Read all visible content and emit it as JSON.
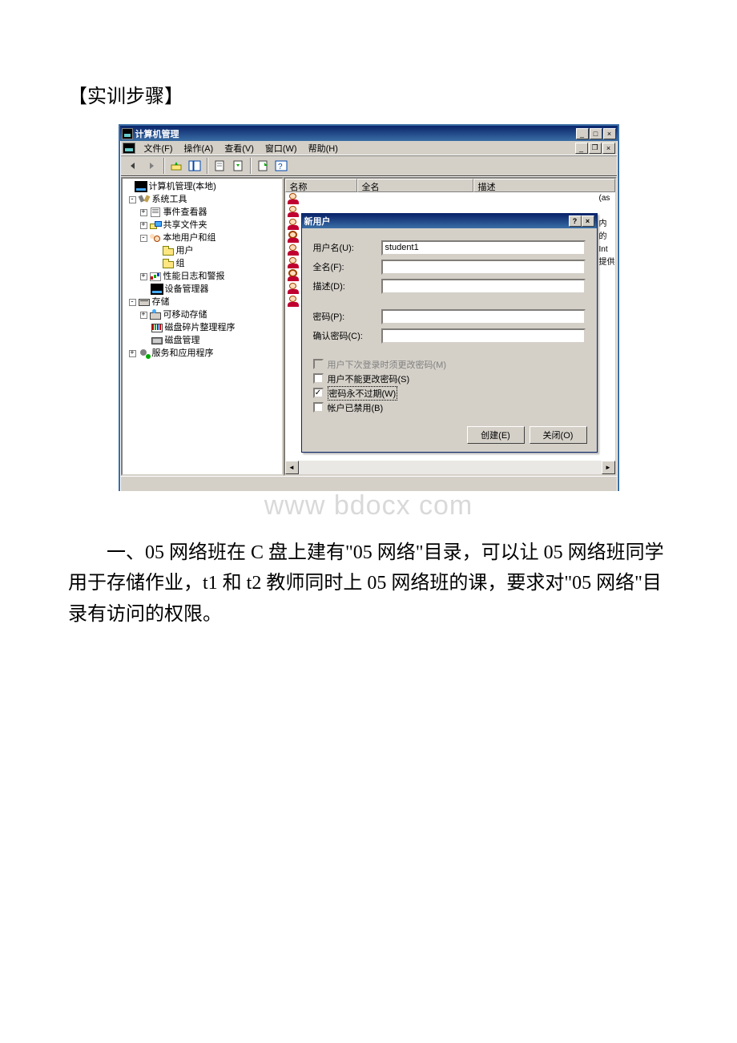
{
  "page": {
    "heading": "【实训步骤】",
    "body": "一、05 网络班在 C 盘上建有\"05 网络\"目录，可以让 05 网络班同学用于存储作业，t1 和 t2 教师同时上 05 网络班的课，要求对\"05 网络\"目录有访问的权限。",
    "watermark": "www bdocx com"
  },
  "window": {
    "title": "计算机管理",
    "menus": {
      "file": "文件(F)",
      "action": "操作(A)",
      "view": "查看(V)",
      "window": "窗口(W)",
      "help": "帮助(H)"
    },
    "tree": {
      "root": "计算机管理(本地)",
      "sys_tools": "系统工具",
      "event_viewer": "事件查看器",
      "shared": "共享文件夹",
      "local_ug": "本地用户和组",
      "users": "用户",
      "groups": "组",
      "perf": "性能日志和警报",
      "devmgr": "设备管理器",
      "storage": "存储",
      "removable": "可移动存储",
      "defrag": "磁盘碎片整理程序",
      "diskmgr": "磁盘管理",
      "services": "服务和应用程序"
    },
    "list": {
      "col_name": "名称",
      "col_full": "全名",
      "col_desc": "描述",
      "frag1": "(as",
      "frag2": "内",
      "frag3": "的",
      "frag4": "Int",
      "frag5": "提供"
    }
  },
  "dialog": {
    "title": "新用户",
    "labels": {
      "username": "用户名(U):",
      "fullname": "全名(F):",
      "desc": "描述(D):",
      "password": "密码(P):",
      "confirm": "确认密码(C):"
    },
    "fields": {
      "username": "student1",
      "fullname": "",
      "desc": "",
      "password": "",
      "confirm": ""
    },
    "checks": {
      "must_change": "用户下次登录时须更改密码(M)",
      "cannot_change": "用户不能更改密码(S)",
      "never_expire": "密码永不过期(W)",
      "disabled": "帐户已禁用(B)"
    },
    "check_state": {
      "must_change": false,
      "cannot_change": false,
      "never_expire": true,
      "disabled": false
    },
    "buttons": {
      "create": "创建(E)",
      "close": "关闭(O)"
    }
  }
}
